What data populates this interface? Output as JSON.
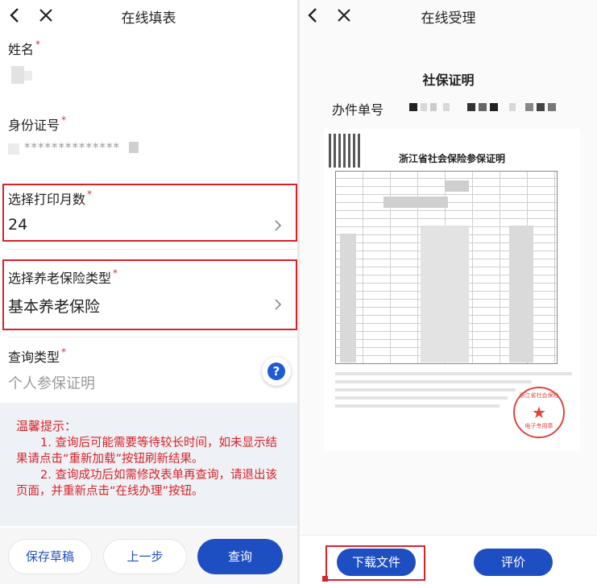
{
  "left": {
    "nav": {
      "title": "在线填表"
    },
    "fields": {
      "name": {
        "label": "姓名",
        "req": "*"
      },
      "id": {
        "label": "身份证号",
        "req": "*",
        "value": "**************"
      },
      "months": {
        "label": "选择打印月数",
        "req": "*",
        "value": "24"
      },
      "pension": {
        "label": "选择养老保险类型",
        "req": "*",
        "value": "基本养老保险"
      },
      "query": {
        "label": "查询类型",
        "req": "*",
        "placeholder": "个人参保证明"
      }
    },
    "help": {
      "icon": "question-icon",
      "glyph": "?"
    },
    "notice": {
      "title": "温馨提示：",
      "p1": "1. 查询后可能需要等待较长时间，如未显示结果请点击“重新加载”按钮刷新结果。",
      "p2": "2. 查询成功后如需修改表单再查询，请退出该页面，并重新点击“在线办理”按钮。"
    },
    "buttons": {
      "save": "保存草稿",
      "prev": "上一步",
      "query": "查询"
    }
  },
  "right": {
    "nav": {
      "title": "在线受理"
    },
    "doc_title": "社保证明",
    "order_label": "办件单号",
    "sheet": {
      "title": "浙江省社会保险参保证明",
      "stamp_ring": "浙江省社会保险",
      "stamp_text": "电子专用章"
    },
    "buttons": {
      "download": "下载文件",
      "rate": "评价"
    }
  },
  "colors": {
    "accent": "#1e4fc2",
    "highlight": "#d8232a",
    "notice_bg": "#eef1f5"
  }
}
